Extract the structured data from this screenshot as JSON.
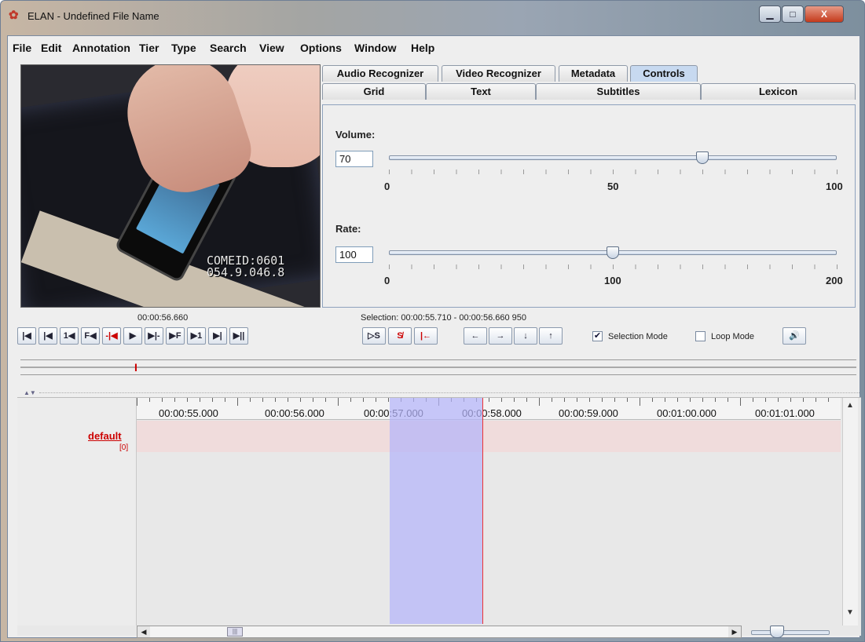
{
  "window": {
    "title": "ELAN - Undefined File Name",
    "app_icon": "elan-app-icon",
    "controls": {
      "minimize": "▁",
      "maximize": "□",
      "close": "X"
    }
  },
  "menu": [
    "File",
    "Edit",
    "Annotation",
    "Tier",
    "Type",
    "Search",
    "View",
    "Options",
    "Window",
    "Help"
  ],
  "video": {
    "overlay_line1": "COMEID:0601",
    "overlay_line2": "054.9.046.8",
    "current_time": "00:00:56.660"
  },
  "tabs": {
    "row1": [
      "Audio Recognizer",
      "Video Recognizer",
      "Metadata",
      "Controls"
    ],
    "row2": [
      "Grid",
      "Text",
      "Subtitles",
      "Lexicon"
    ],
    "selected": "Controls"
  },
  "controls_panel": {
    "volume": {
      "label": "Volume:",
      "value": "70",
      "min": "0",
      "mid": "50",
      "max": "100",
      "level": 70
    },
    "rate": {
      "label": "Rate:",
      "value": "100",
      "min": "0",
      "mid": "100",
      "max": "200",
      "level": 100
    }
  },
  "selection": {
    "text": "Selection: 00:00:55.710 - 00:00:56.660  950"
  },
  "transport_buttons": [
    {
      "name": "go-to-begin-button",
      "glyph": "|◀"
    },
    {
      "name": "previous-frame-button",
      "glyph": "|◀"
    },
    {
      "name": "previous-second-button",
      "glyph": "1◀"
    },
    {
      "name": "frame-back-button",
      "glyph": "F◀"
    },
    {
      "name": "previous-boundary-button",
      "glyph": "-|◀"
    },
    {
      "name": "play-button",
      "glyph": "▶"
    },
    {
      "name": "next-boundary-button",
      "glyph": "▶|-"
    },
    {
      "name": "frame-forward-button",
      "glyph": "▶F"
    },
    {
      "name": "next-second-button",
      "glyph": "▶1"
    },
    {
      "name": "next-frame-button",
      "glyph": "▶|"
    },
    {
      "name": "go-to-end-button",
      "glyph": "▶||"
    }
  ],
  "selection_buttons": [
    {
      "name": "play-selection-button",
      "glyph": "▷S"
    },
    {
      "name": "clear-selection-button",
      "glyph": "S̸"
    },
    {
      "name": "selection-begin-button",
      "glyph": "|←"
    }
  ],
  "nav_buttons": [
    {
      "name": "move-left-button",
      "glyph": "←"
    },
    {
      "name": "move-right-button",
      "glyph": "→"
    },
    {
      "name": "move-down-button",
      "glyph": "↓"
    },
    {
      "name": "move-up-button",
      "glyph": "↑"
    }
  ],
  "modes": {
    "selection_mode": {
      "label": "Selection Mode",
      "checked": true,
      "mark": "✔"
    },
    "loop_mode": {
      "label": "Loop Mode",
      "checked": false,
      "mark": ""
    }
  },
  "speaker_icon": "🔊",
  "ruler": {
    "labels": [
      "00:00:55.000",
      "00:00:56.000",
      "00:00:57.000",
      "00:00:58.000",
      "00:00:59.000",
      "00:01:00.000",
      "00:01:01.000"
    ]
  },
  "tier": {
    "name": "default",
    "count": "[0]"
  },
  "scroll": {
    "up": "▲",
    "down": "▼",
    "left": "◀",
    "right": "▶",
    "thumb": "|||"
  }
}
